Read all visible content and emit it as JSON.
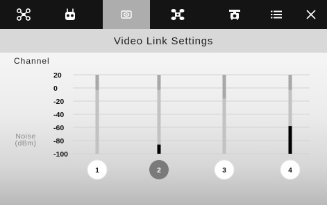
{
  "toolbar": {
    "buttons": [
      {
        "icon": "aircraft-icon",
        "active": false
      },
      {
        "icon": "remote-controller-icon",
        "active": false
      },
      {
        "icon": "video-link-icon",
        "active": true
      },
      {
        "icon": "gimbal-icon",
        "active": false
      },
      {
        "icon": "camera-drone-icon",
        "active": false
      },
      {
        "icon": "list-icon",
        "active": false
      },
      {
        "icon": "close-icon",
        "active": false
      }
    ]
  },
  "title": "Video Link Settings",
  "section_label": "Channel",
  "colors": {
    "toolbar_bg": "#141414",
    "active_tab_bg": "#adadad",
    "noise_bar": "#000000",
    "bar_track": "#c2c2c2",
    "bar_track_top": "#a8a8a8",
    "selected_channel": "#7a7a7a",
    "channel_button": "#ffffff"
  },
  "chart_data": {
    "type": "bar",
    "ylabel_lines": [
      "Noise",
      "(dBm)"
    ],
    "yticks": [
      "20",
      "0",
      "-20",
      "-40",
      "-60",
      "-80",
      "-100"
    ],
    "ylim": [
      -100,
      20
    ],
    "categories": [
      "1",
      "2",
      "3",
      "4"
    ],
    "selected": "2",
    "series": [
      {
        "values": [
          -100,
          -86,
          -100,
          -58
        ]
      }
    ],
    "upper_marker": [
      -3,
      -3,
      -16,
      -3
    ],
    "grid": true
  }
}
